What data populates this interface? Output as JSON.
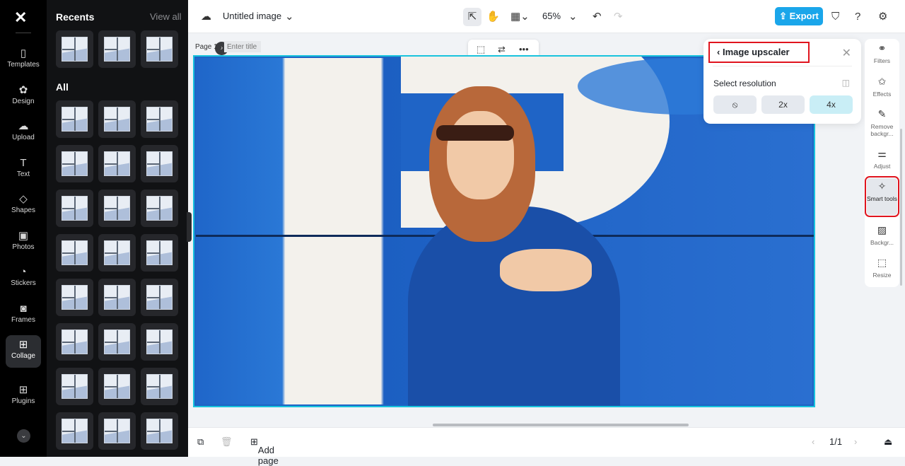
{
  "rail": {
    "items": [
      {
        "label": "Templates",
        "icon": "▯"
      },
      {
        "label": "Design",
        "icon": "✿"
      },
      {
        "label": "Upload",
        "icon": "☁"
      },
      {
        "label": "Text",
        "icon": "T"
      },
      {
        "label": "Shapes",
        "icon": "◇"
      },
      {
        "label": "Photos",
        "icon": "▣"
      },
      {
        "label": "Stickers",
        "icon": "◔"
      },
      {
        "label": "Frames",
        "icon": "◙"
      },
      {
        "label": "Collage",
        "icon": "⊞"
      },
      {
        "label": "Plugins",
        "icon": "⊞"
      }
    ],
    "active": "Collage"
  },
  "panel": {
    "recents_title": "Recents",
    "view_all": "View all",
    "all_title": "All",
    "recent_count": 3,
    "all_count": 24
  },
  "top": {
    "doc_title": "Untitled image",
    "zoom": "65%",
    "export": "Export"
  },
  "page": {
    "label": "Page 1 -",
    "title_placeholder": "Enter title"
  },
  "upscaler": {
    "title": "Image upscaler",
    "select_label": "Select resolution",
    "options": [
      "2x",
      "4x"
    ],
    "selected": "4x"
  },
  "tools": [
    {
      "label": "Filters",
      "icon": "⚭"
    },
    {
      "label": "Effects",
      "icon": "✩"
    },
    {
      "label": "Remove backgr...",
      "icon": "✎"
    },
    {
      "label": "Adjust",
      "icon": "⚌"
    },
    {
      "label": "Smart tools",
      "icon": "✧"
    },
    {
      "label": "Backgr...",
      "icon": "▨"
    },
    {
      "label": "Resize",
      "icon": "⬚"
    }
  ],
  "bottom": {
    "add_page": "Add page",
    "page_count": "1/1"
  },
  "colors": {
    "accent": "#1aa6ea",
    "highlight": "#e0141e",
    "selection": "#19c3dd"
  }
}
